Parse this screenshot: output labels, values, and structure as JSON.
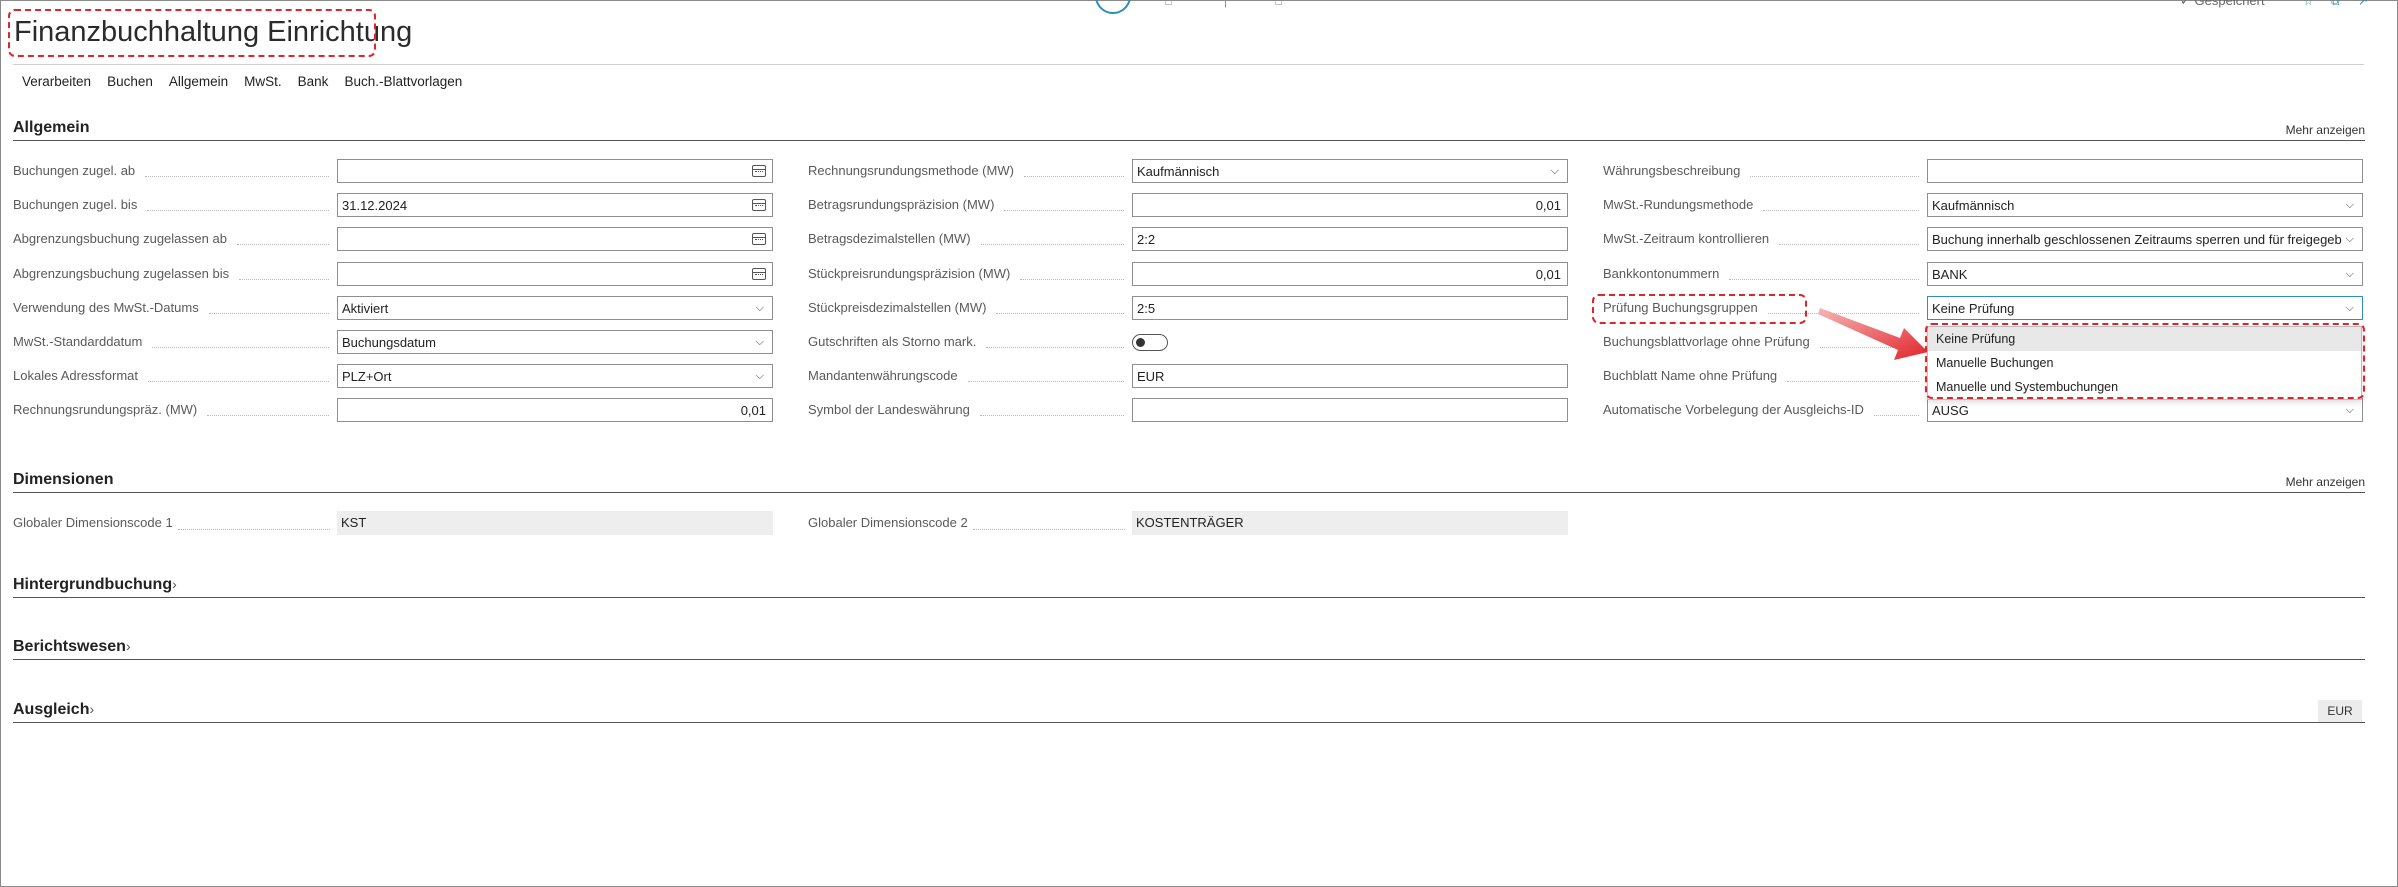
{
  "header": {
    "title": "Finanzbuchhaltung Einrichtung",
    "status": "Gespeichert"
  },
  "actions": [
    "Verarbeiten",
    "Buchen",
    "Allgemein",
    "MwSt.",
    "Bank",
    "Buch.-Blattvorlagen"
  ],
  "allgemein": {
    "title": "Allgemein",
    "more": "Mehr anzeigen",
    "col1": [
      {
        "label": "Buchungen zugel. ab",
        "value": "",
        "kind": "date"
      },
      {
        "label": "Buchungen zugel. bis",
        "value": "31.12.2024",
        "kind": "date"
      },
      {
        "label": "Abgrenzungsbuchung zugelassen ab",
        "value": "",
        "kind": "date"
      },
      {
        "label": "Abgrenzungsbuchung zugelassen bis",
        "value": "",
        "kind": "date"
      },
      {
        "label": "Verwendung des MwSt.-Datums",
        "value": "Aktiviert",
        "kind": "select"
      },
      {
        "label": "MwSt.-Standarddatum",
        "value": "Buchungsdatum",
        "kind": "select"
      },
      {
        "label": "Lokales Adressformat",
        "value": "PLZ+Ort",
        "kind": "select"
      },
      {
        "label": "Rechnungsrundungspräz. (MW)",
        "value": "0,01",
        "kind": "number"
      }
    ],
    "col2": [
      {
        "label": "Rechnungsrundungsmethode (MW)",
        "value": "Kaufmännisch",
        "kind": "select"
      },
      {
        "label": "Betragsrundungspräzision (MW)",
        "value": "0,01",
        "kind": "number"
      },
      {
        "label": "Betragsdezimalstellen (MW)",
        "value": "2:2",
        "kind": "text"
      },
      {
        "label": "Stückpreisrundungspräzision (MW)",
        "value": "0,01",
        "kind": "number"
      },
      {
        "label": "Stückpreisdezimalstellen (MW)",
        "value": "2:5",
        "kind": "text"
      },
      {
        "label": "Gutschriften als Storno mark.",
        "value": "",
        "kind": "toggle"
      },
      {
        "label": "Mandantenwährungscode",
        "value": "EUR",
        "kind": "text"
      },
      {
        "label": "Symbol der Landeswährung",
        "value": "",
        "kind": "text"
      }
    ],
    "col3": [
      {
        "label": "Währungsbeschreibung",
        "value": "",
        "kind": "text"
      },
      {
        "label": "MwSt.-Rundungsmethode",
        "value": "Kaufmännisch",
        "kind": "select"
      },
      {
        "label": "MwSt.-Zeitraum kontrollieren",
        "value": "Buchung innerhalb geschlossenen Zeitraums sperren und für freigegeb",
        "kind": "select"
      },
      {
        "label": "Bankkontonummern",
        "value": "BANK",
        "kind": "select"
      },
      {
        "label": "Prüfung Buchungsgruppen",
        "value": "Keine Prüfung",
        "kind": "select"
      },
      {
        "label": "Buchungsblattvorlage ohne Prüfung",
        "value": "",
        "kind": "hidden"
      },
      {
        "label": "Buchblatt Name ohne Prüfung",
        "value": "",
        "kind": "hidden"
      },
      {
        "label": "Automatische Vorbelegung der Ausgleichs-ID",
        "value": "AUSG",
        "kind": "select"
      }
    ],
    "toggle_on": false
  },
  "dropdown": {
    "options": [
      "Keine Prüfung",
      "Manuelle Buchungen",
      "Manuelle und Systembuchungen"
    ],
    "selected": "Keine Prüfung"
  },
  "dimensionen": {
    "title": "Dimensionen",
    "more": "Mehr anzeigen",
    "dim1_label": "Globaler Dimensionscode 1",
    "dim1_value": "KST",
    "dim2_label": "Globaler Dimensionscode 2",
    "dim2_value": "KOSTENTRÄGER"
  },
  "collapsed_sections": [
    "Hintergrundbuchung",
    "Berichtswesen",
    "Ausgleich"
  ],
  "ausgleich_badge": "EUR",
  "colors": {
    "accent": "#2e8fb8",
    "annotation": "#e0242b"
  }
}
